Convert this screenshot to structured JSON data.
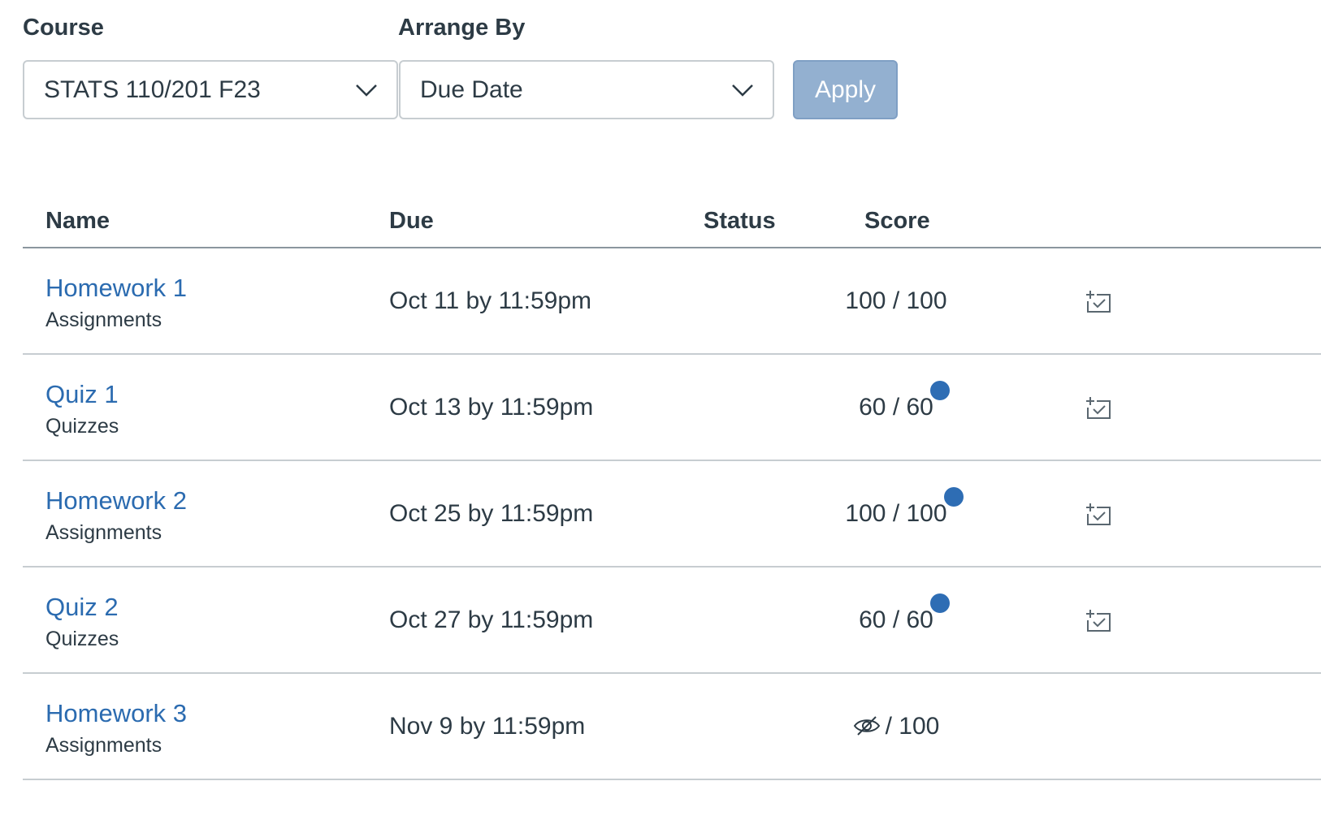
{
  "filters": {
    "course_label": "Course",
    "course_value": "STATS 110/201 F23",
    "arrange_label": "Arrange By",
    "arrange_value": "Due Date",
    "apply_label": "Apply"
  },
  "table": {
    "headers": {
      "name": "Name",
      "due": "Due",
      "status": "Status",
      "score": "Score"
    },
    "rows": [
      {
        "name": "Homework 1",
        "type": "Assignments",
        "due": "Oct 11 by 11:59pm",
        "status": "",
        "score_value": "100",
        "score_sep": " / ",
        "score_total": "100",
        "unread": false,
        "score_hidden": false,
        "planner": true
      },
      {
        "name": "Quiz 1",
        "type": "Quizzes",
        "due": "Oct 13 by 11:59pm",
        "status": "",
        "score_value": "60",
        "score_sep": " / ",
        "score_total": "60",
        "unread": true,
        "score_hidden": false,
        "planner": true
      },
      {
        "name": "Homework 2",
        "type": "Assignments",
        "due": "Oct 25 by 11:59pm",
        "status": "",
        "score_value": "100",
        "score_sep": " / ",
        "score_total": "100",
        "unread": true,
        "score_hidden": false,
        "planner": true
      },
      {
        "name": "Quiz 2",
        "type": "Quizzes",
        "due": "Oct 27 by 11:59pm",
        "status": "",
        "score_value": "60",
        "score_sep": " / ",
        "score_total": "60",
        "unread": true,
        "score_hidden": false,
        "planner": true
      },
      {
        "name": "Homework 3",
        "type": "Assignments",
        "due": "Nov 9 by 11:59pm",
        "status": "",
        "score_value": "",
        "score_sep": "/ ",
        "score_total": "100",
        "unread": false,
        "score_hidden": true,
        "planner": false
      }
    ]
  },
  "icons": {
    "dropdown": "chevron-down-icon",
    "planner": "add-to-planner-icon",
    "hidden_score": "eye-slash-icon",
    "unread": "unread-dot-icon"
  },
  "colors": {
    "link": "#2b6bb0",
    "apply_bg": "#93b0d0",
    "unread_dot": "#2e6db4",
    "text": "#2d3b45"
  }
}
